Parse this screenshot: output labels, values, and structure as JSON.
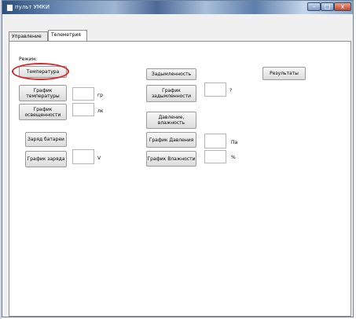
{
  "window": {
    "title": "пульт УМКИ",
    "buttons": {
      "minimize": "–",
      "maximize": "□",
      "close": "x"
    }
  },
  "tabs": [
    {
      "label": "Управление",
      "active": false
    },
    {
      "label": "Телеметрия",
      "active": true
    }
  ],
  "telemetry": {
    "mode_label": "Режим:",
    "buttons": {
      "temperature": "Температура",
      "temp_graph": "График температуры",
      "light_graph": "График освещенности",
      "battery_charge": "Заряд батареи",
      "charge_graph": "График заряда",
      "smoke": "Задымленность",
      "smoke_graph": "График задымленности",
      "pressure_humidity": "Давление, влажность",
      "pressure_graph": "График Давления",
      "humidity_graph": "График Влажности",
      "results": "Результаты"
    },
    "units": {
      "temp": "гр",
      "light": "лк",
      "charge": "V",
      "smoke": "?",
      "pressure": "Па",
      "humidity": "%"
    },
    "values": {
      "temp": "",
      "light": "",
      "charge": "",
      "smoke": "",
      "pressure": "",
      "humidity": ""
    }
  },
  "annotation": {
    "highlight_color": "#d42a2a"
  }
}
